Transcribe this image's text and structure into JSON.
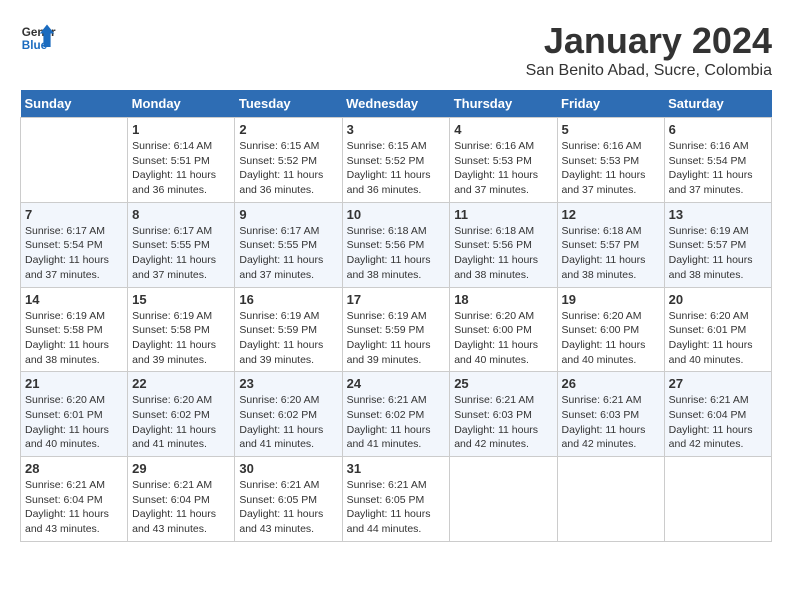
{
  "header": {
    "logo_general": "General",
    "logo_blue": "Blue",
    "month_title": "January 2024",
    "location": "San Benito Abad, Sucre, Colombia"
  },
  "days_of_week": [
    "Sunday",
    "Monday",
    "Tuesday",
    "Wednesday",
    "Thursday",
    "Friday",
    "Saturday"
  ],
  "weeks": [
    [
      {
        "day": "",
        "info": ""
      },
      {
        "day": "1",
        "info": "Sunrise: 6:14 AM\nSunset: 5:51 PM\nDaylight: 11 hours\nand 36 minutes."
      },
      {
        "day": "2",
        "info": "Sunrise: 6:15 AM\nSunset: 5:52 PM\nDaylight: 11 hours\nand 36 minutes."
      },
      {
        "day": "3",
        "info": "Sunrise: 6:15 AM\nSunset: 5:52 PM\nDaylight: 11 hours\nand 36 minutes."
      },
      {
        "day": "4",
        "info": "Sunrise: 6:16 AM\nSunset: 5:53 PM\nDaylight: 11 hours\nand 37 minutes."
      },
      {
        "day": "5",
        "info": "Sunrise: 6:16 AM\nSunset: 5:53 PM\nDaylight: 11 hours\nand 37 minutes."
      },
      {
        "day": "6",
        "info": "Sunrise: 6:16 AM\nSunset: 5:54 PM\nDaylight: 11 hours\nand 37 minutes."
      }
    ],
    [
      {
        "day": "7",
        "info": "Sunrise: 6:17 AM\nSunset: 5:54 PM\nDaylight: 11 hours\nand 37 minutes."
      },
      {
        "day": "8",
        "info": "Sunrise: 6:17 AM\nSunset: 5:55 PM\nDaylight: 11 hours\nand 37 minutes."
      },
      {
        "day": "9",
        "info": "Sunrise: 6:17 AM\nSunset: 5:55 PM\nDaylight: 11 hours\nand 37 minutes."
      },
      {
        "day": "10",
        "info": "Sunrise: 6:18 AM\nSunset: 5:56 PM\nDaylight: 11 hours\nand 38 minutes."
      },
      {
        "day": "11",
        "info": "Sunrise: 6:18 AM\nSunset: 5:56 PM\nDaylight: 11 hours\nand 38 minutes."
      },
      {
        "day": "12",
        "info": "Sunrise: 6:18 AM\nSunset: 5:57 PM\nDaylight: 11 hours\nand 38 minutes."
      },
      {
        "day": "13",
        "info": "Sunrise: 6:19 AM\nSunset: 5:57 PM\nDaylight: 11 hours\nand 38 minutes."
      }
    ],
    [
      {
        "day": "14",
        "info": "Sunrise: 6:19 AM\nSunset: 5:58 PM\nDaylight: 11 hours\nand 38 minutes."
      },
      {
        "day": "15",
        "info": "Sunrise: 6:19 AM\nSunset: 5:58 PM\nDaylight: 11 hours\nand 39 minutes."
      },
      {
        "day": "16",
        "info": "Sunrise: 6:19 AM\nSunset: 5:59 PM\nDaylight: 11 hours\nand 39 minutes."
      },
      {
        "day": "17",
        "info": "Sunrise: 6:19 AM\nSunset: 5:59 PM\nDaylight: 11 hours\nand 39 minutes."
      },
      {
        "day": "18",
        "info": "Sunrise: 6:20 AM\nSunset: 6:00 PM\nDaylight: 11 hours\nand 40 minutes."
      },
      {
        "day": "19",
        "info": "Sunrise: 6:20 AM\nSunset: 6:00 PM\nDaylight: 11 hours\nand 40 minutes."
      },
      {
        "day": "20",
        "info": "Sunrise: 6:20 AM\nSunset: 6:01 PM\nDaylight: 11 hours\nand 40 minutes."
      }
    ],
    [
      {
        "day": "21",
        "info": "Sunrise: 6:20 AM\nSunset: 6:01 PM\nDaylight: 11 hours\nand 40 minutes."
      },
      {
        "day": "22",
        "info": "Sunrise: 6:20 AM\nSunset: 6:02 PM\nDaylight: 11 hours\nand 41 minutes."
      },
      {
        "day": "23",
        "info": "Sunrise: 6:20 AM\nSunset: 6:02 PM\nDaylight: 11 hours\nand 41 minutes."
      },
      {
        "day": "24",
        "info": "Sunrise: 6:21 AM\nSunset: 6:02 PM\nDaylight: 11 hours\nand 41 minutes."
      },
      {
        "day": "25",
        "info": "Sunrise: 6:21 AM\nSunset: 6:03 PM\nDaylight: 11 hours\nand 42 minutes."
      },
      {
        "day": "26",
        "info": "Sunrise: 6:21 AM\nSunset: 6:03 PM\nDaylight: 11 hours\nand 42 minutes."
      },
      {
        "day": "27",
        "info": "Sunrise: 6:21 AM\nSunset: 6:04 PM\nDaylight: 11 hours\nand 42 minutes."
      }
    ],
    [
      {
        "day": "28",
        "info": "Sunrise: 6:21 AM\nSunset: 6:04 PM\nDaylight: 11 hours\nand 43 minutes."
      },
      {
        "day": "29",
        "info": "Sunrise: 6:21 AM\nSunset: 6:04 PM\nDaylight: 11 hours\nand 43 minutes."
      },
      {
        "day": "30",
        "info": "Sunrise: 6:21 AM\nSunset: 6:05 PM\nDaylight: 11 hours\nand 43 minutes."
      },
      {
        "day": "31",
        "info": "Sunrise: 6:21 AM\nSunset: 6:05 PM\nDaylight: 11 hours\nand 44 minutes."
      },
      {
        "day": "",
        "info": ""
      },
      {
        "day": "",
        "info": ""
      },
      {
        "day": "",
        "info": ""
      }
    ]
  ]
}
